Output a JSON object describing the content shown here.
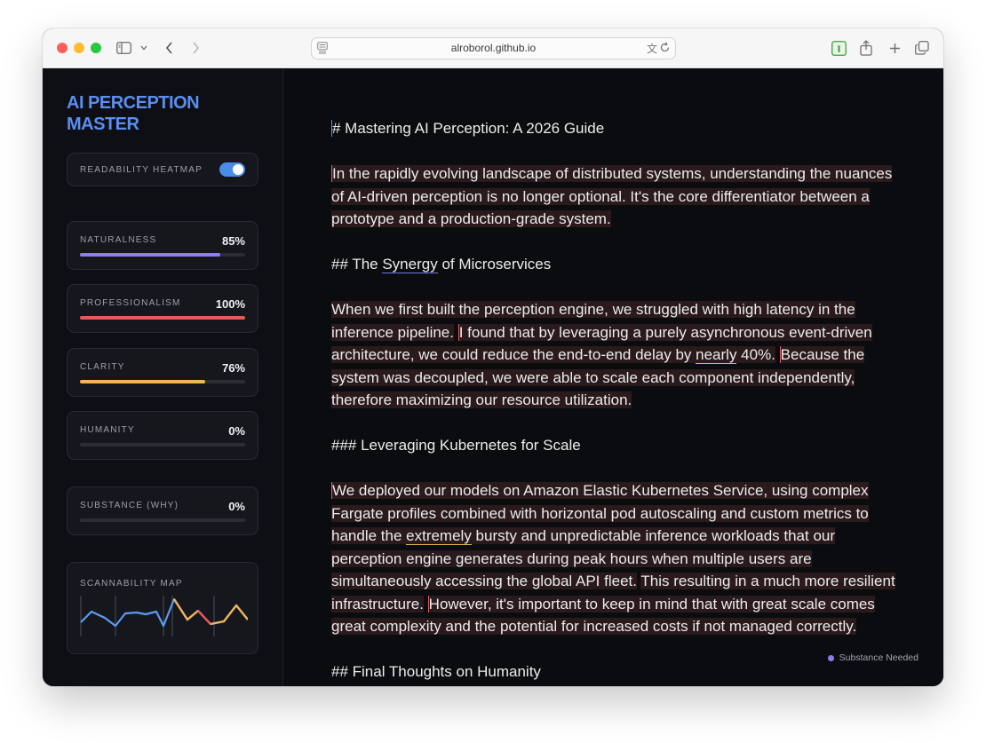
{
  "browser": {
    "url": "alroborol.github.io"
  },
  "sidebar": {
    "brand_line1": "AI PERCEPTION",
    "brand_line2": "MASTER",
    "heatmap_label": "READABILITY HEATMAP",
    "heatmap_on": true,
    "metrics": [
      {
        "label": "NATURALNESS",
        "value": "85%",
        "level": 0.85,
        "color": "#8f7cf2"
      },
      {
        "label": "PROFESSIONALISM",
        "value": "100%",
        "level": 1.0,
        "color": "#e8575a"
      },
      {
        "label": "CLARITY",
        "value": "76%",
        "level": 0.76,
        "color": "#f0b45a"
      },
      {
        "label": "HUMANITY",
        "value": "0%",
        "level": 0.0,
        "color": "#8f7cf2"
      },
      {
        "label": "SUBSTANCE (WHY)",
        "value": "0%",
        "level": 0.0,
        "color": "#8f7cf2"
      }
    ],
    "scannability_label": "SCANNABILITY MAP"
  },
  "document": {
    "h1": "# Mastering AI Perception: A 2026 Guide",
    "intro": "In the rapidly evolving landscape of distributed systems, understanding the nuances of AI-driven perception is no longer optional. It's the core differentiator between a prototype and a production-grade system.",
    "h2_prefix": "## The ",
    "h2_word": "Synergy",
    "h2_suffix": " of Microservices",
    "p2_a": "When we first built the perception engine, we struggled with high latency in the inference pipeline.",
    "p2_b_pre": "I found that by leveraging a purely asynchronous event-driven architecture, we could reduce the end-to-end delay by ",
    "p2_b_word": "nearly",
    "p2_b_post": " 40%.",
    "p2_c": "Because the system was decoupled, we were able to scale each component independently, therefore maximizing our resource utilization.",
    "h3": "### Leveraging Kubernetes for Scale",
    "p3_a_pre": "We deployed our models on Amazon Elastic Kubernetes Service, using complex Fargate profiles combined with horizontal pod autoscaling and custom metrics to handle the ",
    "p3_a_word": "extremely",
    "p3_a_post": " bursty and unpredictable inference workloads that our perception engine generates during peak hours when multiple users are simultaneously accessing the global API fleet.",
    "p3_b": "This resulting in a much more resilient infrastructure.",
    "p3_c": "However, it's important to keep in mind that with great scale comes great complexity and the potential for increased costs if not managed correctly.",
    "h2b": "## Final Thoughts on Humanity"
  },
  "legend": {
    "label": "Substance Needed"
  }
}
